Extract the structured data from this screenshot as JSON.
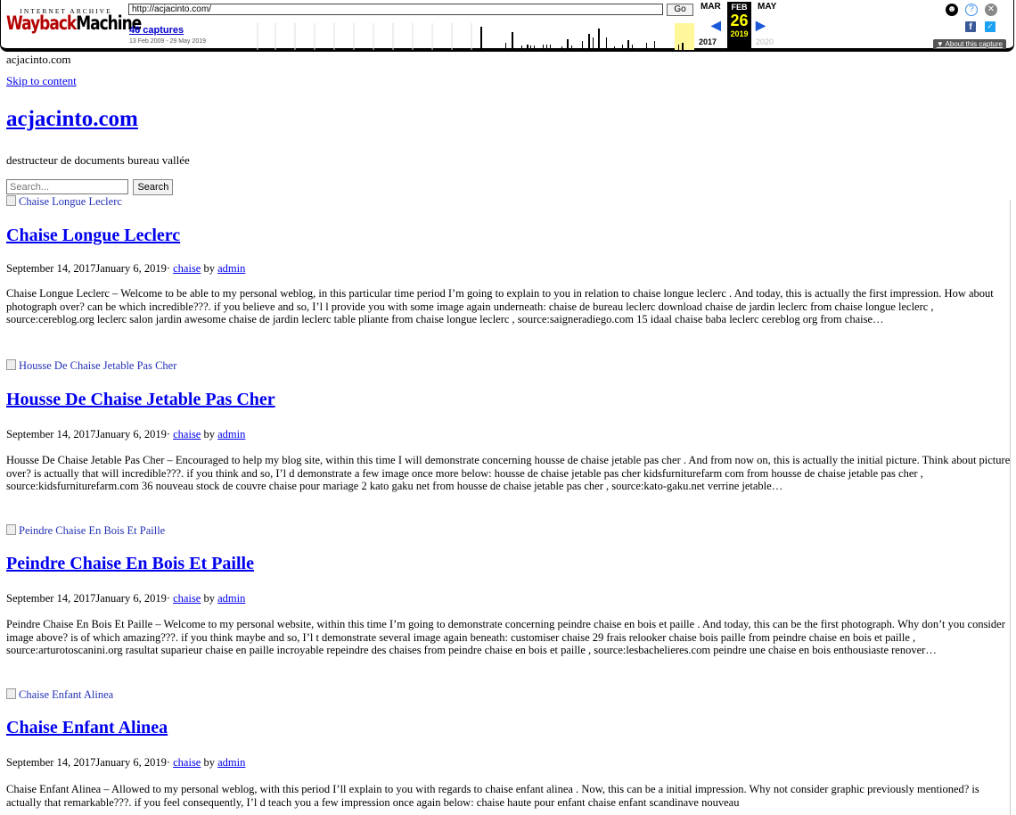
{
  "wayback": {
    "logo_top": "INTERNET ARCHIVE",
    "logo_main_1": "Wayback",
    "logo_main_2": "Machine",
    "url": "http://acjacinto.com/",
    "go_label": "Go",
    "captures": "46 captures",
    "range": "13 Feb 2009 - 29 May 2019",
    "month_prev": "MAR",
    "month_cur": "FEB",
    "month_next": "MAY",
    "day": "26",
    "year_prev": "2017",
    "year_cur": "2019",
    "year_next": "2020",
    "about": "▼ About this capture"
  },
  "page": {
    "top_text": "acjacinto.com",
    "skip_link": "Skip to content",
    "site_title": "acjacinto.com",
    "description": "destructeur de documents bureau vallée",
    "search_placeholder": "Search...",
    "search_button": "Search"
  },
  "posts": [
    {
      "image_alt": "Chaise Longue Leclerc",
      "title": "Chaise Longue Leclerc",
      "date": "September 14, 2017January 6, 2019",
      "sep": "· ",
      "category": "chaise",
      "by": " by ",
      "author": "admin",
      "excerpt": "Chaise Longue Leclerc – Welcome to be able to my personal weblog, in this particular time period I’m going to explain to you in relation to chaise longue leclerc . And today, this is actually the first impression. How about photograph over? can be which incredible???. if you believe and so, I’l l provide you with some image again underneath: chaise de bureau leclerc download chaise de jardin leclerc from chaise longue leclerc , source:cereblog.org leclerc salon jardin awesome chaise de jardin leclerc table pliante from chaise longue leclerc , source:saigneradiego.com 15 idaal chaise baba leclerc cereblog org from chaise…"
    },
    {
      "image_alt": "Housse De Chaise Jetable Pas Cher",
      "title": "Housse De Chaise Jetable Pas Cher",
      "date": "September 14, 2017January 6, 2019",
      "sep": "· ",
      "category": "chaise",
      "by": " by ",
      "author": "admin",
      "excerpt": "Housse De Chaise Jetable Pas Cher – Encouraged to help my blog site, within this time I will demonstrate concerning housse de chaise jetable pas cher . And from now on, this is actually the initial picture. Think about picture over? is actually that will incredible???. if you think and so, I’l d demonstrate a few image once more below: housse de chaise jetable pas cher kidsfurniturefarm com from housse de chaise jetable pas cher , source:kidsfurniturefarm.com 36 nouveau stock de couvre chaise pour mariage 2 kato gaku net from housse de chaise jetable pas cher , source:kato-gaku.net verrine jetable…"
    },
    {
      "image_alt": "Peindre Chaise En Bois Et Paille",
      "title": "Peindre Chaise En Bois Et Paille",
      "date": "September 14, 2017January 6, 2019",
      "sep": "· ",
      "category": "chaise",
      "by": " by ",
      "author": "admin",
      "excerpt": "Peindre Chaise En Bois Et Paille – Welcome to my personal website, within this time I’m going to demonstrate concerning peindre chaise en bois et paille . And today, this can be the first photograph. Why don’t you consider image above? is of which amazing???. if you think maybe and so, I’l t demonstrate several image again beneath: customiser chaise 29 frais relooker chaise bois paille from peindre chaise en bois et paille , source:arturotoscanini.org rasultat suparieur chaise en paille incroyable repeindre des chaises from peindre chaise en bois et paille , source:lesbachelieres.com peindre une chaise en bois enthousiaste renover…"
    },
    {
      "image_alt": "Chaise Enfant Alinea",
      "title": "Chaise Enfant Alinea",
      "date": "September 14, 2017January 6, 2019",
      "sep": "· ",
      "category": "chaise",
      "by": " by ",
      "author": "admin",
      "excerpt": "Chaise Enfant Alinea – Allowed to my personal weblog, with this period I’ll explain to you with regards to chaise enfant alinea . Now, this can be a initial impression. Why not consider graphic previously mentioned? is actually that remarkable???. if you feel consequently, I’l d teach you a few impression once again below: chaise haute pour enfant chaise enfant scandinave nouveau"
    }
  ]
}
